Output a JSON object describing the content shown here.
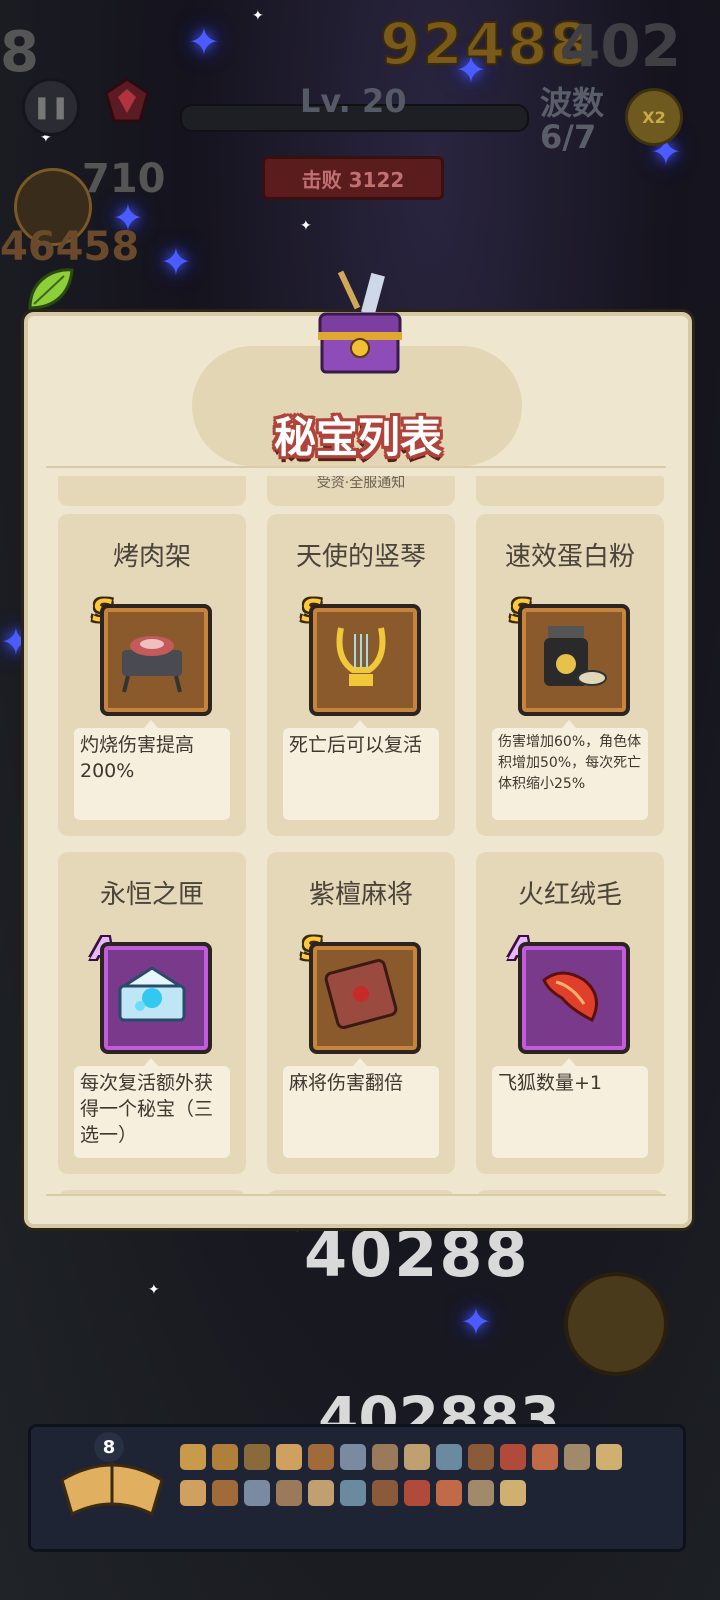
{
  "hud": {
    "level": "Lv. 20",
    "score": "92488",
    "score_partial": "402",
    "wave_label": "波数",
    "wave_value": "6/7",
    "speed": "X2",
    "kills": "击败 3122",
    "left_number_top": "8",
    "left_number_mid": "710",
    "left_number_low": "46458"
  },
  "panel": {
    "title": "秘宝列表",
    "partial_text": "受资·全服通知"
  },
  "treasures": [
    {
      "name": "烤肉架",
      "grade": "S",
      "desc": "灼烧伤害提高200%",
      "icon": "grill-icon"
    },
    {
      "name": "天使的竖琴",
      "grade": "S",
      "desc": "死亡后可以复活",
      "icon": "lyre-icon"
    },
    {
      "name": "速效蛋白粉",
      "grade": "S",
      "desc": "伤害增加60%，角色体积增加50%，每次死亡体积缩小25%",
      "icon": "protein-jar-icon"
    },
    {
      "name": "永恒之匣",
      "grade": "A",
      "desc": "每次复活额外获得一个秘宝（三选一）",
      "icon": "crystal-box-icon"
    },
    {
      "name": "紫檀麻将",
      "grade": "S",
      "desc": "麻将伤害翻倍",
      "icon": "mahjong-tile-icon"
    },
    {
      "name": "火红绒毛",
      "grade": "A",
      "desc": "飞狐数量+1",
      "icon": "red-fur-icon"
    }
  ],
  "battle": {
    "big_number_1": "40288",
    "big_number_1_overlay": "40288",
    "big_number_1_suffix": "8",
    "big_number_2": "402883"
  },
  "bottom": {
    "book_count": "8"
  },
  "colors": {
    "grade_s": "#c6843c",
    "grade_a": "#c35cdc",
    "panel_bg": "#efe6cf",
    "title_stroke": "#b0443a"
  }
}
